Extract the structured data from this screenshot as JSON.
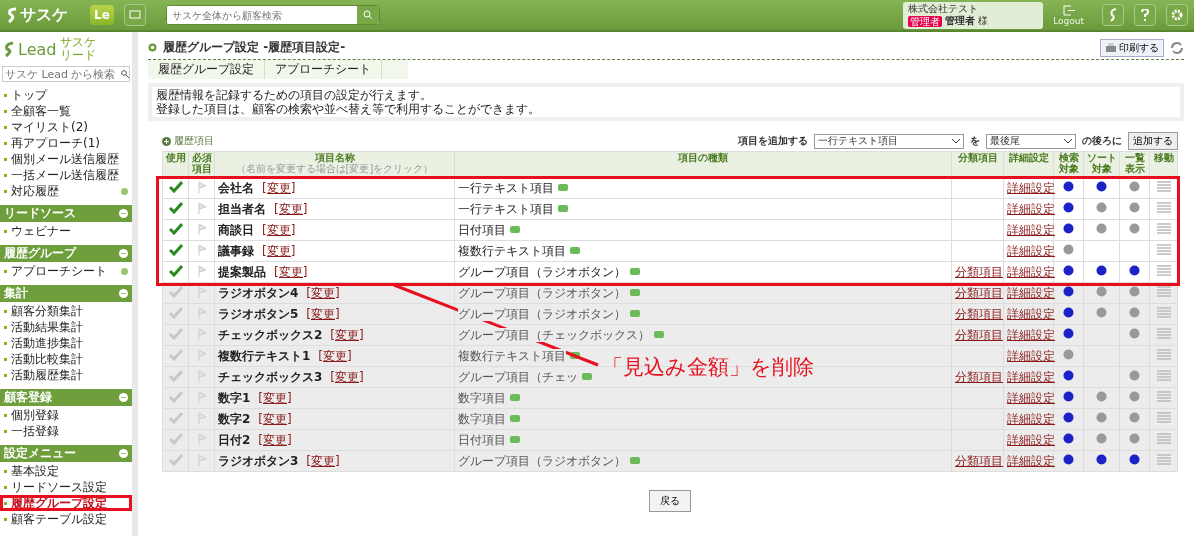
{
  "header": {
    "logo": "サスケ",
    "app_badge": "Le",
    "search": {
      "placeholder": "サスケ全体から顧客検索"
    },
    "company": "株式会社テスト",
    "role_badge": "管理者",
    "user_name": "管理者",
    "honorific": "様",
    "logout_label": "Logout"
  },
  "sidebar": {
    "logo": "Lead",
    "logo_sub": [
      "サスケ",
      "リード"
    ],
    "search": {
      "placeholder": "サスケ Lead から検索"
    },
    "items": [
      {
        "label": "トップ",
        "selected": false
      },
      {
        "label": "全顧客一覧",
        "selected": false
      },
      {
        "label": "マイリスト(2)",
        "selected": false
      },
      {
        "label": "再アプローチ(1)",
        "selected": false
      },
      {
        "label": "個別メール送信履歴",
        "selected": false
      },
      {
        "label": "一括メール送信履歴",
        "selected": false
      },
      {
        "label": "対応履歴",
        "selected": false,
        "addable": true
      }
    ],
    "sections": [
      {
        "title": "リードソース",
        "items": [
          {
            "label": "ウェビナー",
            "selected": false
          }
        ]
      },
      {
        "title": "履歴グループ",
        "items": [
          {
            "label": "アプローチシート",
            "selected": false,
            "addable": true
          }
        ]
      },
      {
        "title": "集計",
        "items": [
          {
            "label": "顧客分類集計",
            "selected": false
          },
          {
            "label": "活動結果集計",
            "selected": false
          },
          {
            "label": "活動進捗集計",
            "selected": false
          },
          {
            "label": "活動比較集計",
            "selected": false
          },
          {
            "label": "活動履歴集計",
            "selected": false
          }
        ]
      },
      {
        "title": "顧客登録",
        "items": [
          {
            "label": "個別登録",
            "selected": false
          },
          {
            "label": "一括登録",
            "selected": false
          }
        ]
      },
      {
        "title": "設定メニュー",
        "items": [
          {
            "label": "基本設定",
            "selected": false
          },
          {
            "label": "リードソース設定",
            "selected": false
          },
          {
            "label": "履歴グループ設定",
            "selected": true
          },
          {
            "label": "顧客テーブル設定",
            "selected": false
          }
        ]
      }
    ]
  },
  "page": {
    "title": "履歴グループ設定 -履歴項目設定-",
    "print_button": "印刷する",
    "breadcrumbs": [
      "履歴グループ設定",
      "アプローチシート"
    ],
    "description": [
      "履歴情報を記録するための項目の設定が行えます。",
      "登録した項目は、顧客の検索や並べ替え等で利用することができます。"
    ],
    "section_title": "履歴項目",
    "add_label": "項目を追加する",
    "add_type": "一行テキスト項目",
    "add_particle": "を",
    "add_position": "最後尾",
    "add_suffix": "の後ろに",
    "add_button": "追加する",
    "columns": [
      {
        "label": "使用"
      },
      {
        "label": "必須項目"
      },
      {
        "label": "項目名称",
        "note": "（名前を変更する場合は[変更]をクリック）"
      },
      {
        "label": "項目の種類"
      },
      {
        "label": "分類項目"
      },
      {
        "label": "詳細設定"
      },
      {
        "label": "検索対象"
      },
      {
        "label": "ソート対象"
      },
      {
        "label": "一覧表示"
      },
      {
        "label": "移動"
      }
    ],
    "rows": [
      {
        "name": "会社名",
        "rename": "[変更]",
        "used": true,
        "type": "一行テキスト項目",
        "detail": "詳細設定",
        "search": true,
        "sort": true,
        "list": false
      },
      {
        "name": "担当者名",
        "rename": "[変更]",
        "used": true,
        "type": "一行テキスト項目",
        "detail": "詳細設定",
        "search": true,
        "sort": false,
        "list": false
      },
      {
        "name": "商談日",
        "rename": "[変更]",
        "used": true,
        "type": "日付項目",
        "detail": "詳細設定",
        "search": true,
        "sort": false,
        "list": false
      },
      {
        "name": "議事録",
        "rename": "[変更]",
        "used": true,
        "type": "複数行テキスト項目",
        "detail": "詳細設定",
        "search": false
      },
      {
        "name": "提案製品",
        "rename": "[変更]",
        "used": true,
        "type": "グループ項目（ラジオボタン）",
        "category": "分類項目",
        "detail": "詳細設定",
        "search": true,
        "sort": true,
        "list": true
      },
      {
        "name": "ラジオボタン4",
        "rename": "[変更]",
        "used": false,
        "type": "グループ項目（ラジオボタン）",
        "category": "分類項目",
        "detail": "詳細設定",
        "search": true,
        "sort": false,
        "list": false
      },
      {
        "name": "ラジオボタン5",
        "rename": "[変更]",
        "used": false,
        "type": "グループ項目（ラジオボタン）",
        "category": "分類項目",
        "detail": "詳細設定",
        "search": true,
        "sort": false,
        "list": false
      },
      {
        "name": "チェックボックス2",
        "rename": "[変更]",
        "used": false,
        "type": "グループ項目（チェックボックス）",
        "category": "分類項目",
        "detail": "詳細設定",
        "search": true,
        "list": false
      },
      {
        "name": "複数行テキスト1",
        "rename": "[変更]",
        "used": false,
        "type": "複数行テキスト項目",
        "detail": "詳細設定",
        "search": false
      },
      {
        "name": "チェックボックス3",
        "rename": "[変更]",
        "used": false,
        "type": "グループ項目（チェッ",
        "category": "分類項目",
        "detail": "詳細設定",
        "search": true,
        "list": false
      },
      {
        "name": "数字1",
        "rename": "[変更]",
        "used": false,
        "type": "数字項目",
        "detail": "詳細設定",
        "search": true,
        "sort": false,
        "list": false
      },
      {
        "name": "数字2",
        "rename": "[変更]",
        "used": false,
        "type": "数字項目",
        "detail": "詳細設定",
        "search": true,
        "sort": false,
        "list": false
      },
      {
        "name": "日付2",
        "rename": "[変更]",
        "used": false,
        "type": "日付項目",
        "detail": "詳細設定",
        "search": true,
        "sort": false,
        "list": false
      },
      {
        "name": "ラジオボタン3",
        "rename": "[変更]",
        "used": false,
        "type": "グループ項目（ラジオボタン）",
        "category": "分類項目",
        "detail": "詳細設定",
        "search": true,
        "sort": true,
        "list": true
      }
    ],
    "back_button": "戻る"
  },
  "annotation": {
    "text": "「見込み金額」を削除"
  }
}
